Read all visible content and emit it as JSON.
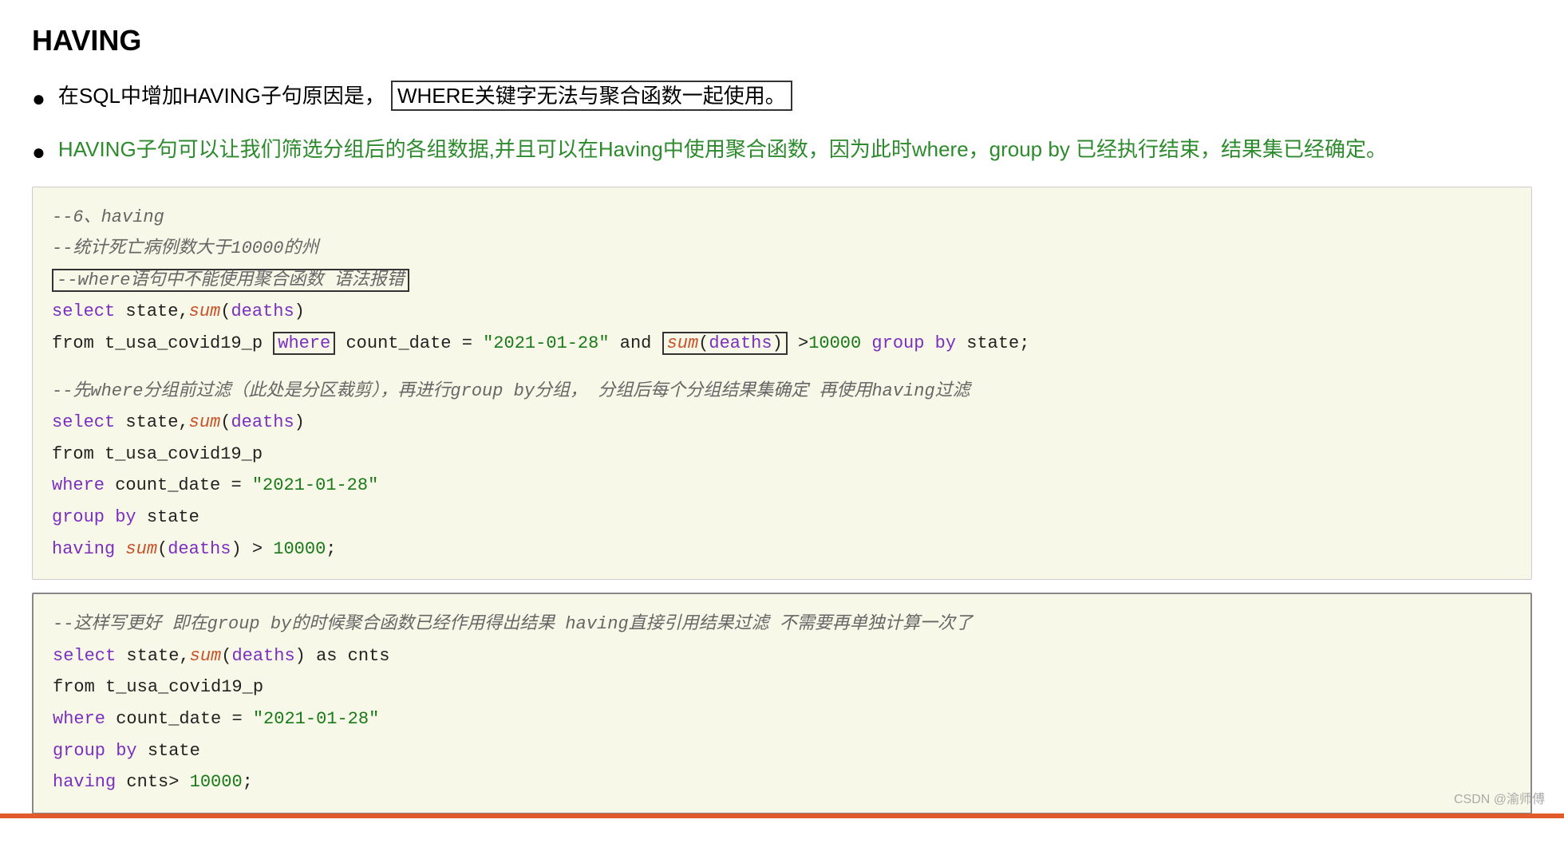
{
  "title": "HAVING",
  "bullets": [
    {
      "text_before": "在SQL中增加HAVING子句原因是，",
      "highlight": "WHERE关键字无法与聚合函数一起使用。",
      "text_after": ""
    },
    {
      "text": "HAVING子句可以让我们筛选分组后的各组数据,并且可以在Having中使用聚合函数，因为此时where，group by 已经执行结束，结果集已经确定。"
    }
  ],
  "code_block_1": {
    "comment1": "--6、having",
    "comment2": "--统计死亡病例数大于10000的州",
    "comment3": "--where语句中不能使用聚合函数  语法报错",
    "line1": "select state,sum(deaths)",
    "line2_before": "from t_usa_covid19_p",
    "line2_where_box": "where",
    "line2_after": "count_date = \"2021-01-28\" and",
    "line2_sum_box": "sum(deaths)",
    "line2_end": ">10000 group by state;"
  },
  "code_block_2": {
    "comment1": "--先where分组前过滤（此处是分区裁剪），再进行group by分组，  分组后每个分组结果集确定 再使用having过滤",
    "line1": "select state,sum(deaths)",
    "line2": "from t_usa_covid19_p",
    "line3": "where count_date = \"2021-01-28\"",
    "line4": "group by state",
    "line5": "having sum(deaths) > 10000;"
  },
  "code_block_3": {
    "comment1": "--这样写更好 即在group by的时候聚合函数已经作用得出结果 having直接引用结果过滤 不需要再单独计算一次了",
    "line1": "select state,sum(deaths) as cnts",
    "line2": "from t_usa_covid19_p",
    "line3": "where count_date = \"2021-01-28\"",
    "line4": "group by state",
    "line5": "having cnts> 10000;"
  },
  "watermark": "CSDN @渝师傅"
}
